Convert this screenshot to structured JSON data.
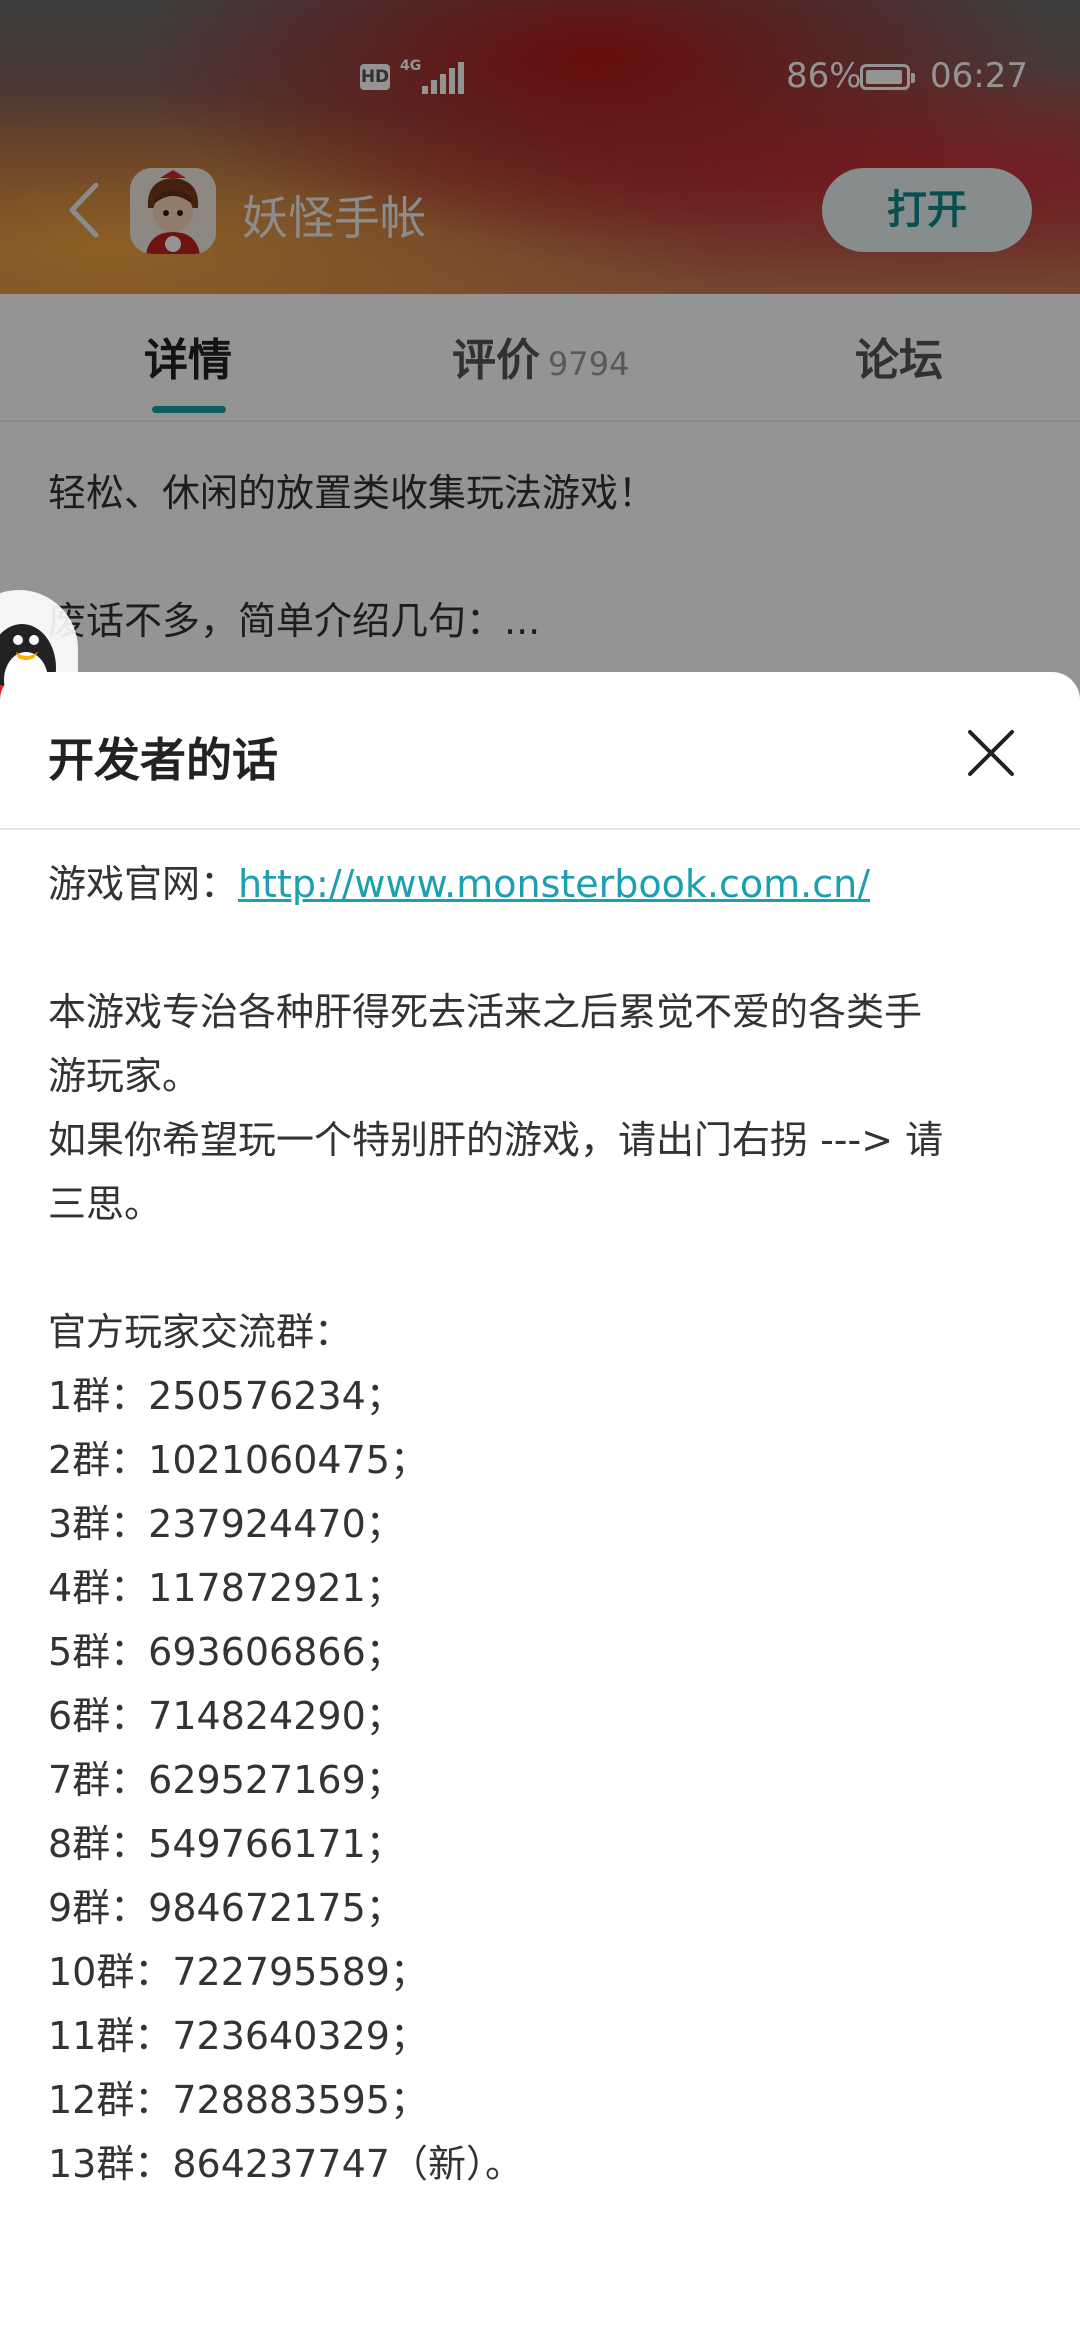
{
  "status_bar": {
    "hd_label": "HD",
    "network": "4G",
    "battery": "86%",
    "time": "06:27"
  },
  "app_header": {
    "app_name": "妖怪手帐",
    "open_label": "打开"
  },
  "tabs": [
    {
      "label": "详情",
      "count": ""
    },
    {
      "label": "评价",
      "count": "9794"
    },
    {
      "label": "论坛",
      "count": ""
    }
  ],
  "description": {
    "line1": "轻松、休闲的放置类收集玩法游戏！",
    "line2": "废话不多，简单介绍几句：..."
  },
  "sheet": {
    "title": "开发者的话",
    "website_label": "游戏官网：",
    "website_url": "http://www.monsterbook.com.cn/",
    "paragraph_lines": [
      "本游戏专治各种肝得死去活来之后累觉不爱的各类手",
      "游玩家。",
      "如果你希望玩一个特别肝的游戏，请出门右拐 ---> 请",
      "三思。"
    ],
    "groups_title": "官方玩家交流群：",
    "groups": [
      "1群：250576234；",
      "2群：1021060475；",
      "3群：237924470；",
      "4群：117872921；",
      "5群：693606866；",
      "6群：714824290；",
      "7群：629527169；",
      "8群：549766171；",
      "9群：984672175；",
      "10群：722795589；",
      "11群：723640329；",
      "12群：728883595；",
      "13群：864237747（新）。"
    ]
  },
  "icons": {
    "back": "chevron-left-icon",
    "close": "close-icon",
    "app": "app-icon",
    "floating": "qq-penguin-icon"
  },
  "colors": {
    "accent": "#15a3a3",
    "link": "#1aa0b0",
    "open_button_text": "#0e8b8b"
  }
}
